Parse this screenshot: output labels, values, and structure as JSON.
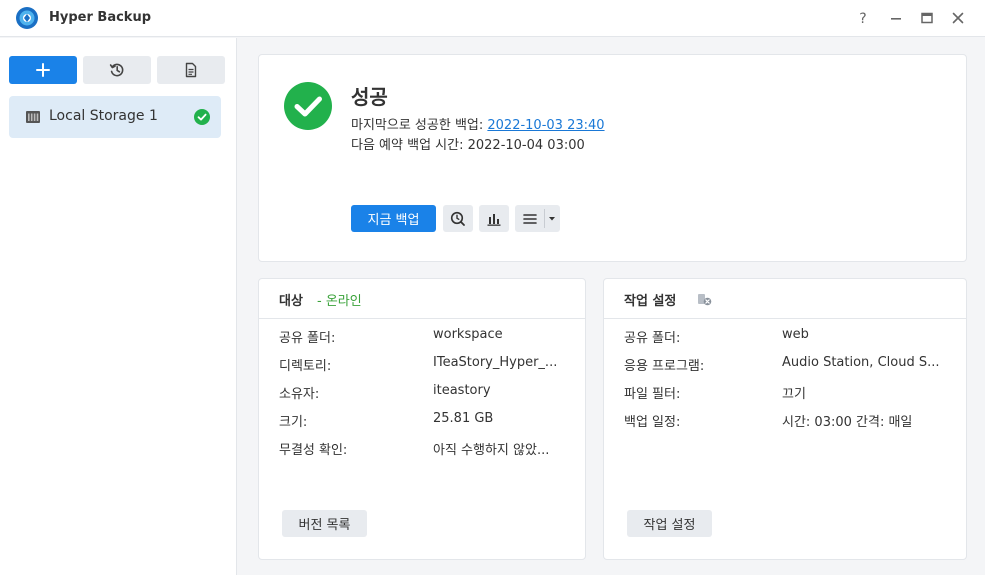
{
  "window": {
    "title": "Hyper Backup"
  },
  "sidebar": {
    "storage_items": [
      {
        "label": "Local Storage 1",
        "status": "success"
      }
    ]
  },
  "status": {
    "title": "성공",
    "last_success_label": "마지막으로 성공한 백업:",
    "last_success_value": "2022-10-03 23:40",
    "next_scheduled_label": "다음 예약 백업 시간:",
    "next_scheduled_value": "2022-10-04 03:00",
    "backup_now_label": "지금 백업"
  },
  "target": {
    "title": "대상",
    "online_text": "- 온라인",
    "rows": [
      {
        "label": "공유 폴더:",
        "value": "workspace"
      },
      {
        "label": "디렉토리:",
        "value": "ITeaStory_Hyper_..."
      },
      {
        "label": "소유자:",
        "value": "iteastory"
      },
      {
        "label": "크기:",
        "value": "25.81 GB"
      },
      {
        "label": "무결성 확인:",
        "value": "아직 수행하지 않았..."
      }
    ],
    "footer_button": "버전 목록"
  },
  "task": {
    "title": "작업 설정",
    "rows": [
      {
        "label": "공유 폴더:",
        "value": "web"
      },
      {
        "label": "응용 프로그램:",
        "value": "Audio Station, Cloud S..."
      },
      {
        "label": "파일 필터:",
        "value": "끄기"
      },
      {
        "label": "백업 일정:",
        "value": "시간: 03:00 간격: 매일"
      }
    ],
    "footer_button": "작업 설정"
  },
  "colors": {
    "accent": "#1a82e8",
    "success": "#22b14c",
    "online": "#3aa23a",
    "link": "#1a78d6"
  }
}
